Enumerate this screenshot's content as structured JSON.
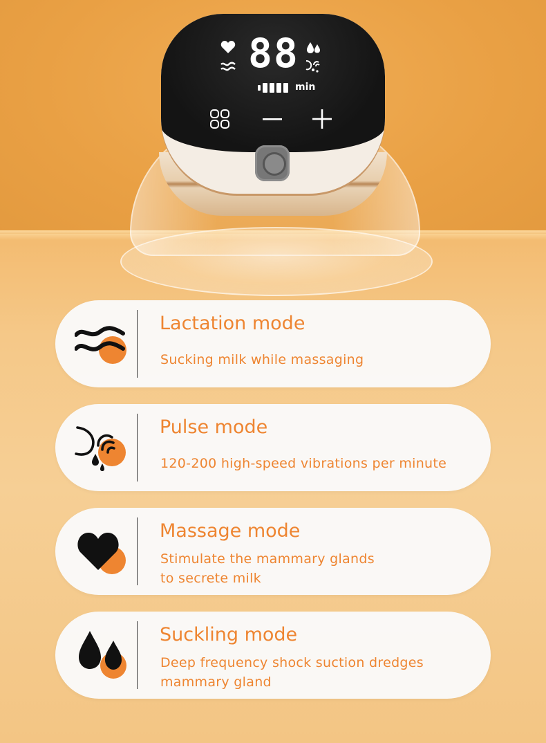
{
  "device": {
    "display_digits": "88",
    "battery_bars": 4,
    "time_unit": "min",
    "buttons": [
      {
        "icon": "mode-grid-icon"
      },
      {
        "icon": "minus-icon"
      },
      {
        "icon": "plus-icon"
      }
    ]
  },
  "colors": {
    "accent": "#ee8531",
    "background": "#eba552",
    "card": "#fafafa"
  },
  "modes": [
    {
      "icon": "wave-icon",
      "title": "Lactation mode",
      "desc": [
        "Sucking milk while massaging"
      ]
    },
    {
      "icon": "pulse-icon",
      "title": "Pulse mode",
      "desc": [
        "120-200 high-speed vibrations per minute"
      ]
    },
    {
      "icon": "heart-icon",
      "title": "Massage mode",
      "desc": [
        "Stimulate the mammary glands",
        "to secrete milk"
      ]
    },
    {
      "icon": "drops-icon",
      "title": "Suckling mode",
      "desc": [
        "Deep frequency shock suction dredges",
        "mammary gland"
      ]
    }
  ]
}
